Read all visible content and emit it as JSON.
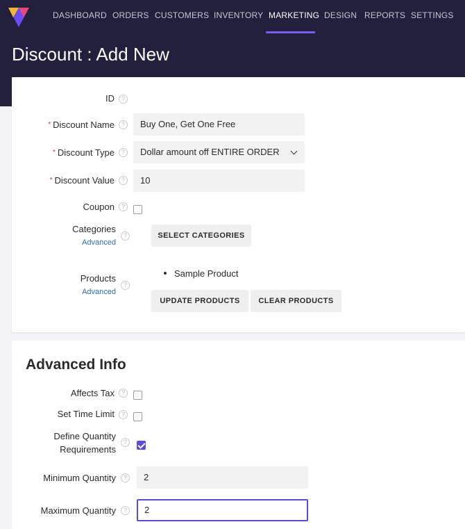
{
  "nav": {
    "items": [
      "DASHBOARD",
      "ORDERS",
      "CUSTOMERS",
      "INVENTORY",
      "MARKETING",
      "DESIGN",
      "REPORTS",
      "SETTINGS"
    ],
    "active": "MARKETING"
  },
  "page": {
    "title": "Discount : Add New"
  },
  "form": {
    "id_label": "ID",
    "discount_name_label": "Discount Name",
    "discount_name_value": "Buy One, Get One Free",
    "discount_type_label": "Discount Type",
    "discount_type_value": "Dollar amount off ENTIRE ORDER",
    "discount_value_label": "Discount Value",
    "discount_value_value": "10",
    "coupon_label": "Coupon",
    "categories_label": "Categories",
    "advanced_link": "Advanced",
    "select_categories_button": "SELECT CATEGORIES",
    "products_label": "Products",
    "products": [
      "Sample Product"
    ],
    "update_products_button": "UPDATE PRODUCTS",
    "clear_products_button": "CLEAR PRODUCTS",
    "required_marker": "*",
    "help_glyph": "?"
  },
  "advanced": {
    "title": "Advanced Info",
    "affects_tax_label": "Affects Tax",
    "set_time_limit_label": "Set Time Limit",
    "define_qty_label_line1": "Define Quantity",
    "define_qty_label_line2": "Requirements",
    "define_qty_checked": true,
    "min_qty_label": "Minimum Quantity",
    "min_qty_value": "2",
    "max_qty_label": "Maximum Quantity",
    "max_qty_value": "2"
  },
  "colors": {
    "topbar": "#22203c",
    "accent": "#5b4bdb",
    "link": "#2a6ebb",
    "required": "#d0304a"
  }
}
